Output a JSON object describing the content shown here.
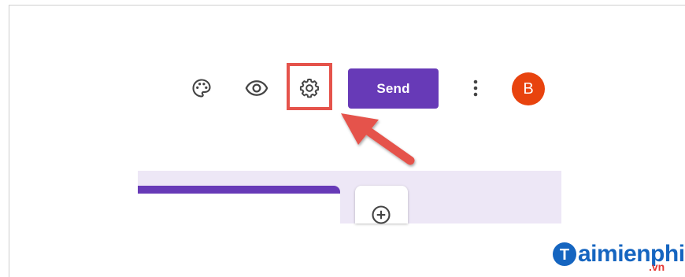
{
  "toolbar": {
    "icons": [
      "palette-icon",
      "eye-icon",
      "gear-icon",
      "more-vert-icon"
    ],
    "send_label": "Send",
    "avatar_initial": "B"
  },
  "callout": {
    "highlight_color": "#e5534b",
    "arrow_color": "#e5534b"
  },
  "editor": {
    "accent": "#673ab7",
    "canvas_bg": "#ede7f6",
    "add_icon": "add-circle-icon"
  },
  "watermark": {
    "brand": "aimienphi",
    "logo_letter": "T",
    "suffix": ".vn"
  }
}
